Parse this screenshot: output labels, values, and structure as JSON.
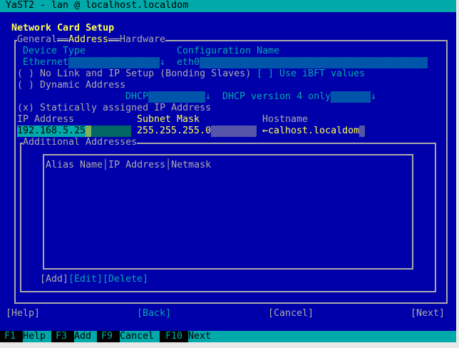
{
  "window": {
    "title": "YaST2 - lan @ localhost.localdom"
  },
  "dialog": {
    "title": "Network Card Setup"
  },
  "tabs": [
    {
      "label": "General"
    },
    {
      "label": "Address",
      "active": true
    },
    {
      "label": "Hardware"
    }
  ],
  "device_type": {
    "label": "Device Type",
    "value": "Ethernet"
  },
  "config_name": {
    "label": "Configuration Name",
    "value": "eth0"
  },
  "options": {
    "no_link": {
      "label": "No Link and IP Setup (Bonding Slaves)",
      "checked": false,
      "mark": "( )"
    },
    "ibft": {
      "label": "Use iBFT values",
      "checked": false,
      "mark": "[ ]"
    },
    "dynamic": {
      "label": "Dynamic Address",
      "checked": false,
      "mark": "( )"
    },
    "dhcp_mode": "DHCP",
    "dhcp_version": "DHCP version 4 only",
    "static": {
      "label": "Statically assigned IP Address",
      "checked": true,
      "mark": "(x)"
    }
  },
  "fields": {
    "ip": {
      "label": "IP Address",
      "value": "192.168.5.25"
    },
    "subnet": {
      "label": "Subnet Mask",
      "value": "255.255.255.0"
    },
    "hostname": {
      "label": "Hostname",
      "value": "←calhost.localdom"
    }
  },
  "additional": {
    "title": "Additional Addresses",
    "columns": "Alias Name│IP Address│Netmask",
    "rows": [],
    "add": "[Add]",
    "edit": "[Edit]",
    "delete": "[Delete]"
  },
  "buttons": {
    "help": "[Help]",
    "back": "[Back]",
    "cancel": "[Cancel]",
    "next": "[Next]"
  },
  "fkeys": [
    {
      "key": "F1",
      "label": "Help"
    },
    {
      "key": "F3",
      "label": "Add"
    },
    {
      "key": "F9",
      "label": "Cancel"
    },
    {
      "key": "F10",
      "label": "Next"
    }
  ],
  "colors": {
    "background": "#0000aa",
    "accent": "#00aaaa",
    "highlight": "#ffff55",
    "text": "#aaaaaa"
  }
}
